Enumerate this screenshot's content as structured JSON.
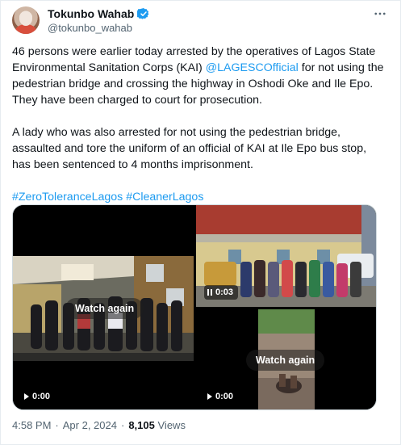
{
  "author": {
    "name": "Tokunbo Wahab",
    "handle": "@tokunbo_wahab",
    "verified_badge_color": "#1d9bf0",
    "avatar_icon": "profile-photo"
  },
  "more_icon": "more-options-icon",
  "tweet": {
    "p1_before": "46 persons were earlier today arrested by the operatives of Lagos State Environmental Sanitation Corps (KAI) ",
    "p1_mention": "@LAGESCOfficial",
    "p1_after": " for not using the pedestrian bridge and crossing the highway in Oshodi Oke and Ile Epo. They have been charged to court for prosecution.",
    "p2": "A lady who was also arrested for not using the pedestrian bridge, assaulted and tore the uniform of an official of KAI at Ile Epo bus stop, has been sentenced to 4 months imprisonment.",
    "hashtag1": "#ZeroToleranceLagos",
    "hashtag2": "#CleanerLagos"
  },
  "media": {
    "video1": {
      "overlay": "Watch again",
      "time": "0:00",
      "control": "play-icon"
    },
    "video2": {
      "time": "0:03",
      "control": "pause-icon"
    },
    "video3": {
      "overlay": "Watch again",
      "time": "0:00",
      "control": "play-icon"
    }
  },
  "footer": {
    "time": "4:58 PM",
    "sep1": "·",
    "date": "Apr 2, 2024",
    "sep2": "·",
    "views_count": "8,105",
    "views_label": "Views"
  },
  "colors": {
    "link": "#1d9bf0",
    "secondary_text": "#536471"
  }
}
